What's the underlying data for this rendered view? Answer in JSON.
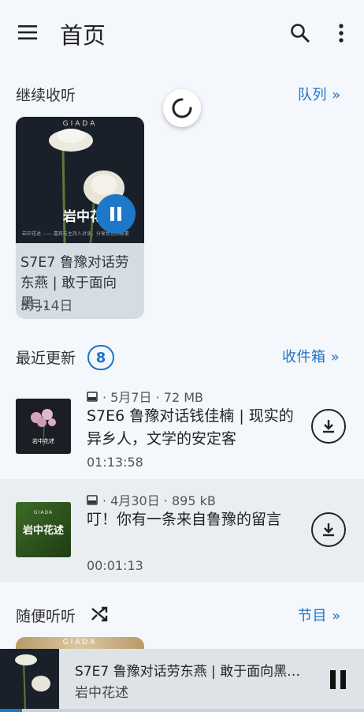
{
  "header": {
    "title": "首页"
  },
  "continue": {
    "title": "继续收听",
    "queue_link": "队列 »",
    "card": {
      "brand": "GIADA",
      "cover_text": "岩中花",
      "title": "S7E7 鲁豫对话劳东燕 | 敢于面向黑…",
      "date": "5月14日"
    }
  },
  "recent": {
    "title": "最近更新",
    "count": "8",
    "inbox_link": "收件箱 »",
    "episodes": [
      {
        "date": "· 5月7日 · 72 MB",
        "title": "S7E6 鲁豫对话钱佳楠 | 现实的异乡人，文学的安定客",
        "duration": "01:13:58",
        "cover_text": "岩中花述"
      },
      {
        "date": "· 4月30日 · 895 kB",
        "title": "叮！你有一条来自鲁豫的留言",
        "duration": "00:01:13",
        "cover_brand": "GIADA",
        "cover_text": "岩中花述"
      }
    ]
  },
  "random": {
    "title": "随便听听",
    "shows_link": "节目 »",
    "peek_brand": "GIADA"
  },
  "player": {
    "title": "S7E7 鲁豫对话劳东燕 | 敢于面向黑…",
    "subtitle": "岩中花述",
    "progress": 0.06
  },
  "icons": {
    "menu": "menu-icon",
    "search": "search-icon",
    "more": "more-vert-icon",
    "pause": "pause-icon",
    "download": "download-icon",
    "inbox": "inbox-icon",
    "shuffle": "shuffle-icon",
    "loading": "loading-spinner-icon"
  },
  "colors": {
    "accent": "#1a73c8",
    "background": "#f4f7fb",
    "player_bg": "#dfe3e8"
  }
}
